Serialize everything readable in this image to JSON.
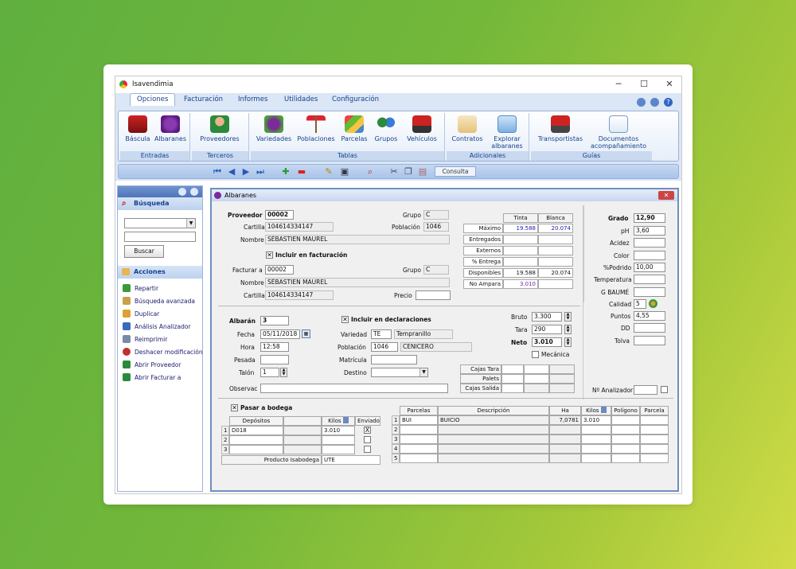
{
  "window": {
    "title": "Isavendimia"
  },
  "ribbon": {
    "tabs": [
      "Opciones",
      "Facturación",
      "Informes",
      "Utilidades",
      "Configuración"
    ],
    "groups": [
      {
        "label": "Entradas",
        "buttons": [
          "Báscula",
          "Albaranes"
        ]
      },
      {
        "label": "Terceros",
        "buttons": [
          "Proveedores"
        ]
      },
      {
        "label": "Tablas",
        "buttons": [
          "Variedades",
          "Poblaciones",
          "Parcelas",
          "Grupos",
          "Vehículos"
        ]
      },
      {
        "label": "Adicionales",
        "buttons": [
          "Contratos",
          "Explorar albaranes"
        ]
      },
      {
        "label": "Guías",
        "buttons": [
          "Transportistas",
          "Documentos acompañamiento"
        ]
      }
    ],
    "consulta": "Consulta"
  },
  "sidebar": {
    "busqueda": "Búsqueda",
    "buscar": "Buscar",
    "acciones": "Acciones",
    "actions": [
      "Repartir",
      "Búsqueda avanzada",
      "Duplicar",
      "Análisis Analizador",
      "Reimprimir",
      "Deshacer modificación",
      "Abrir Proveedor",
      "Abrir Facturar a"
    ]
  },
  "form": {
    "title": "Albaranes",
    "proveedor": {
      "label": "Proveedor",
      "value": "00002",
      "cartilla_label": "Cartilla",
      "cartilla": "104614334147",
      "nombre_label": "Nombre",
      "nombre": "SÉBASTIEN MAUREL",
      "grupo_label": "Grupo",
      "grupo": "C",
      "poblacion_label": "Población",
      "poblacion": "1046"
    },
    "incluir_facturacion": "Incluir en facturación",
    "facturar": {
      "label": "Facturar a",
      "value": "00002",
      "grupo_label": "Grupo",
      "grupo": "C",
      "nombre_label": "Nombre",
      "nombre": "SÉBASTIEN MAUREL",
      "cartilla_label": "Cartilla",
      "cartilla": "104614334147",
      "precio_label": "Precio"
    },
    "stats": {
      "col_tinta": "Tinta",
      "col_blanca": "Blanca",
      "rows": [
        {
          "label": "Máximo",
          "tinta": "19.588",
          "blanca": "20.074"
        },
        {
          "label": "Entregados",
          "tinta": "",
          "blanca": ""
        },
        {
          "label": "Externos",
          "tinta": "",
          "blanca": ""
        },
        {
          "label": "% Entrega",
          "tinta": "",
          "blanca": ""
        },
        {
          "label": "Disponibles",
          "tinta": "19.588",
          "blanca": "20.074"
        },
        {
          "label": "No Ampara",
          "tinta": "3.010",
          "blanca": ""
        }
      ]
    },
    "albaran": {
      "label": "Albarán",
      "value": "3",
      "fecha_label": "Fecha",
      "fecha": "05/11/2018",
      "hora_label": "Hora",
      "hora": "12:58",
      "pesada_label": "Pesada",
      "talon_label": "Talón",
      "talon": "1",
      "observ_label": "Observac"
    },
    "incluir_declaraciones": "Incluir en declaraciones",
    "variedad": {
      "label": "Variedad",
      "code": "TE",
      "name": "Tempranillo"
    },
    "poblacion2": {
      "label": "Población",
      "code": "1046",
      "name": "CENICERO"
    },
    "matricula_label": "Matrícula",
    "destino_label": "Destino",
    "pesos": {
      "bruto_label": "Bruto",
      "bruto": "3.300",
      "tara_label": "Tara",
      "tara": "290",
      "neto_label": "Neto",
      "neto": "3.010",
      "mecanica": "Mecánica"
    },
    "cajas": [
      "Cajas Tara",
      "Palets",
      "Cajas Salida"
    ],
    "analysis": {
      "grado_label": "Grado",
      "grado": "12,90",
      "ph_label": "pH",
      "ph": "3,60",
      "acidez_label": "Acidez",
      "color_label": "Color",
      "podrido_label": "%Podrido",
      "podrido": "10,00",
      "temperatura_label": "Temperatura",
      "baume_label": "G BAUMÉ",
      "calidad_label": "Calidad",
      "calidad": "5",
      "puntos_label": "Puntos",
      "puntos": "4,55",
      "dd_label": "DD",
      "tolva_label": "Tolva",
      "analizador_label": "Nº Analizador"
    },
    "bodega": {
      "label": "Pasar a bodega",
      "col_depositos": "Depósitos",
      "col_kilos": "Kilos",
      "col_enviado": "Enviado",
      "rows": [
        {
          "n": "1",
          "deposito": "D018",
          "kilos": "3.010",
          "enviado": "X"
        },
        {
          "n": "2",
          "deposito": "",
          "kilos": "",
          "enviado": ""
        },
        {
          "n": "3",
          "deposito": "",
          "kilos": "",
          "enviado": ""
        }
      ],
      "producto_label": "Producto Isabodega",
      "producto": "UTE"
    },
    "parcelas": {
      "cols": [
        "Parcelas",
        "Descripción",
        "Ha",
        "Kilos",
        "Polígono",
        "Parcela"
      ],
      "rows": [
        {
          "n": "1",
          "parcela": "BUI",
          "desc": "BUICIO",
          "ha": "7,0781",
          "kilos": "3.010"
        },
        {
          "n": "2"
        },
        {
          "n": "3"
        },
        {
          "n": "4"
        },
        {
          "n": "5"
        }
      ]
    }
  }
}
